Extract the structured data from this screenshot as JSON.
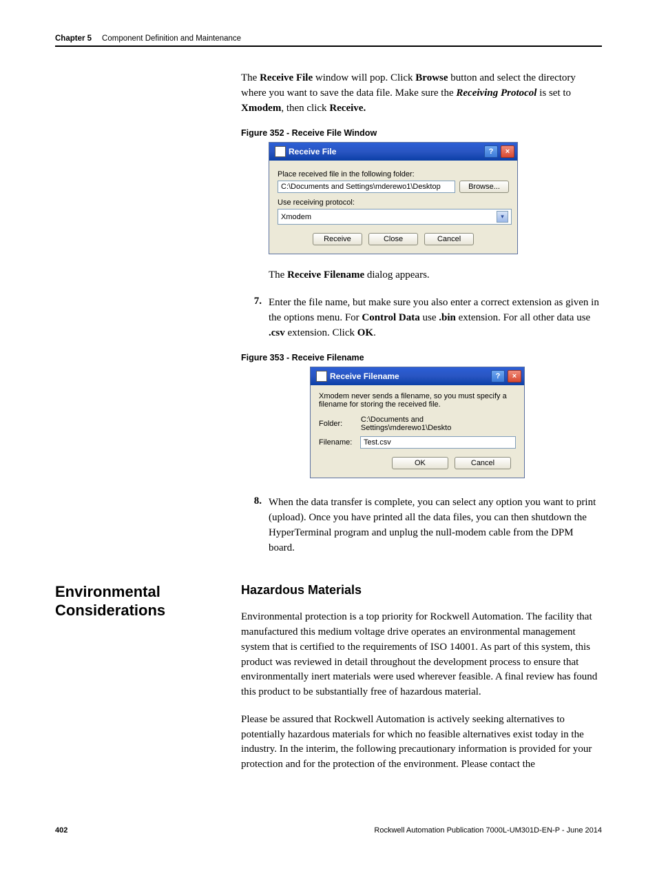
{
  "header": {
    "chapter": "Chapter 5",
    "title": "Component Definition and Maintenance"
  },
  "intro": {
    "p1a": "The ",
    "p1b": "Receive File",
    "p1c": " window will pop. Click ",
    "p1d": "Browse",
    "p1e": " button and select the directory where you want to save the data file. Make sure the ",
    "p1f": "Receiving Protocol",
    "p1g": " is set to ",
    "p1h": "Xmodem",
    "p1i": ", then click ",
    "p1j": "Receive."
  },
  "fig352": {
    "caption": "Figure 352 - Receive File Window",
    "title": "Receive File",
    "label_folder": "Place received file in the following folder:",
    "folder_value": "C:\\Documents and Settings\\mderewo1\\Desktop",
    "browse": "Browse...",
    "label_proto": "Use receiving protocol:",
    "proto_value": "Xmodem",
    "btn_receive": "Receive",
    "btn_close": "Close",
    "btn_cancel": "Cancel"
  },
  "mid": {
    "p2a": "The ",
    "p2b": "Receive Filename",
    "p2c": " dialog appears."
  },
  "steps": {
    "n7": "7.",
    "s7a": "Enter the file name, but make sure you also enter a correct extension as given in the options menu. For ",
    "s7b": "Control Data",
    "s7c": " use ",
    "s7d": ".bin",
    "s7e": " extension. For all other data use ",
    "s7f": ".csv",
    "s7g": " extension. Click ",
    "s7h": "OK",
    "s7i": ".",
    "n8": "8.",
    "s8": "When the data transfer is complete, you can select any option you want to print (upload). Once you have printed all the data files, you can then shutdown the HyperTerminal program and unplug the null-modem cable from the DPM board."
  },
  "fig353": {
    "caption": "Figure 353 - Receive Filename",
    "title": "Receive Filename",
    "desc": "Xmodem never sends a filename, so you must specify a filename for storing the received file.",
    "lbl_folder": "Folder:",
    "folder_value": "C:\\Documents and Settings\\mderewo1\\Deskto",
    "lbl_filename": "Filename:",
    "filename_value": "Test.csv",
    "btn_ok": "OK",
    "btn_cancel": "Cancel"
  },
  "env": {
    "sidebar": "Environmental Considerations",
    "h2": "Hazardous Materials",
    "p1": "Environmental protection is a top priority for Rockwell Automation. The facility that manufactured this medium voltage drive operates an environmental management system that is certified to the requirements of ISO 14001. As part of this system, this product was reviewed in detail throughout the development process to ensure that environmentally inert materials were used wherever feasible. A final review has found this product to be substantially free of hazardous material.",
    "p2": "Please be assured that Rockwell Automation is actively seeking alternatives to potentially hazardous materials for which no feasible alternatives exist today in the industry. In the interim, the following precautionary information is provided for your protection and for the protection of the environment. Please contact the"
  },
  "footer": {
    "page": "402",
    "pub": "Rockwell Automation Publication 7000L-UM301D-EN-P - June 2014"
  }
}
